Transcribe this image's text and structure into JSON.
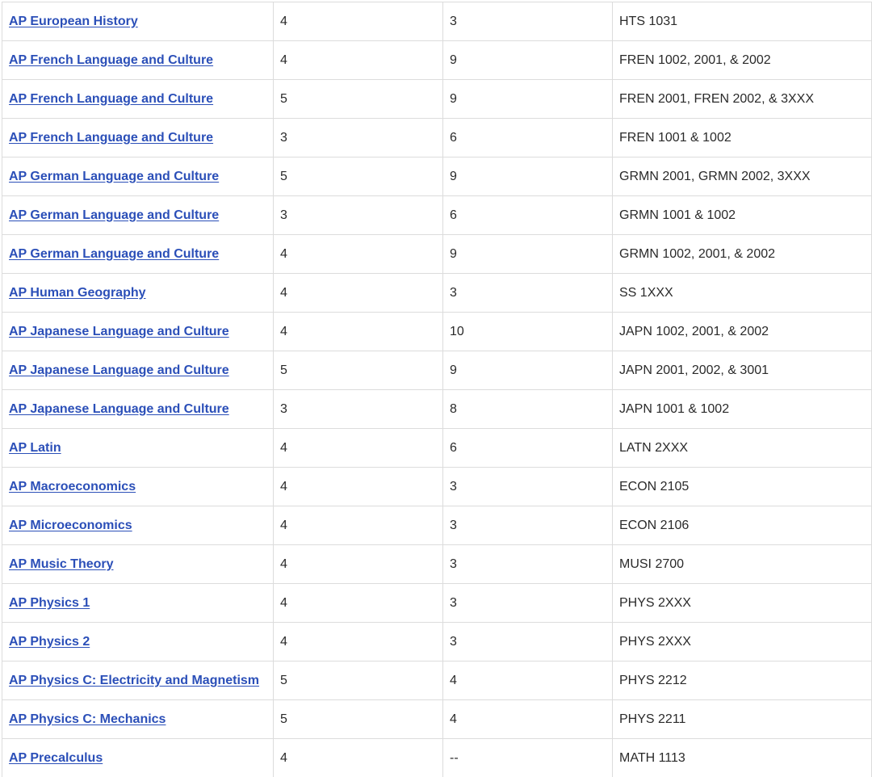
{
  "table": {
    "rows": [
      {
        "exam": "AP European History",
        "score": "4",
        "hours": "3",
        "course": "HTS 1031"
      },
      {
        "exam": "AP French Language and Culture",
        "score": "4",
        "hours": "9",
        "course": "FREN 1002, 2001, & 2002"
      },
      {
        "exam": "AP French Language and Culture",
        "score": "5",
        "hours": "9",
        "course": "FREN 2001, FREN 2002, & 3XXX"
      },
      {
        "exam": "AP French Language and Culture",
        "score": "3",
        "hours": "6",
        "course": "FREN 1001 & 1002"
      },
      {
        "exam": "AP German Language and Culture",
        "score": "5",
        "hours": "9",
        "course": "GRMN 2001, GRMN 2002, 3XXX"
      },
      {
        "exam": "AP German Language and Culture",
        "score": "3",
        "hours": "6",
        "course": "GRMN 1001 & 1002"
      },
      {
        "exam": "AP German Language and Culture",
        "score": "4",
        "hours": "9",
        "course": "GRMN 1002, 2001, & 2002"
      },
      {
        "exam": "AP Human Geography",
        "score": "4",
        "hours": "3",
        "course": "SS 1XXX"
      },
      {
        "exam": "AP Japanese Language and Culture",
        "score": "4",
        "hours": "10",
        "course": "JAPN 1002, 2001, & 2002"
      },
      {
        "exam": "AP Japanese Language and Culture",
        "score": "5",
        "hours": "9",
        "course": "JAPN 2001, 2002, & 3001"
      },
      {
        "exam": "AP Japanese Language and Culture",
        "score": "3",
        "hours": "8",
        "course": "JAPN 1001 & 1002"
      },
      {
        "exam": "AP Latin",
        "score": "4",
        "hours": "6",
        "course": "LATN 2XXX"
      },
      {
        "exam": "AP Macroeconomics",
        "score": "4",
        "hours": "3",
        "course": "ECON 2105"
      },
      {
        "exam": "AP Microeconomics",
        "score": "4",
        "hours": "3",
        "course": "ECON 2106"
      },
      {
        "exam": "AP Music Theory",
        "score": "4",
        "hours": "3",
        "course": "MUSI 2700"
      },
      {
        "exam": "AP Physics 1",
        "score": "4",
        "hours": "3",
        "course": "PHYS 2XXX"
      },
      {
        "exam": "AP Physics 2",
        "score": "4",
        "hours": "3",
        "course": "PHYS 2XXX"
      },
      {
        "exam": "AP Physics C: Electricity and Magnetism",
        "score": "5",
        "hours": "4",
        "course": "PHYS 2212"
      },
      {
        "exam": "AP Physics C: Mechanics",
        "score": "5",
        "hours": "4",
        "course": "PHYS 2211"
      },
      {
        "exam": "AP Precalculus",
        "score": "4",
        "hours": "--",
        "course": "MATH 1113"
      }
    ]
  },
  "colors": {
    "link": "#2b4fb8",
    "text": "#2a2a2a",
    "border": "#dcdcdc",
    "background": "#ffffff"
  }
}
